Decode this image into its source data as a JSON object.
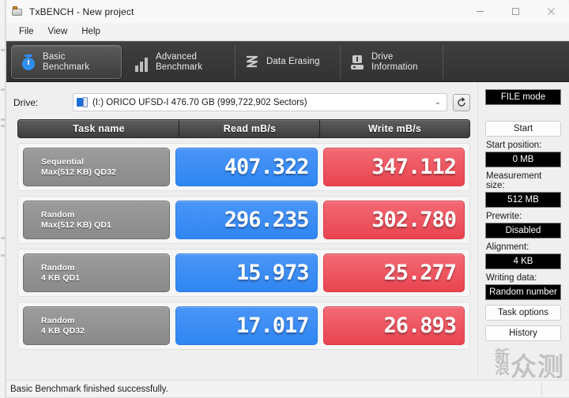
{
  "window": {
    "title": "TxBENCH - New project",
    "app_icon": "txbench-icon",
    "buttons": {
      "minimize": "minimize-icon",
      "maximize": "maximize-icon",
      "close": "close-icon"
    }
  },
  "menubar": {
    "items": [
      {
        "label": "File"
      },
      {
        "label": "View"
      },
      {
        "label": "Help"
      }
    ]
  },
  "tabs": [
    {
      "label": "Basic\nBenchmark",
      "icon": "stopwatch-icon",
      "active": true
    },
    {
      "label": "Advanced\nBenchmark",
      "icon": "bar-chart-icon",
      "active": false
    },
    {
      "label": "Data Erasing",
      "icon": "erase-icon",
      "active": false
    },
    {
      "label": "Drive\nInformation",
      "icon": "hard-drive-icon",
      "active": false
    }
  ],
  "drive": {
    "label": "Drive:",
    "value": "(I:) ORICO UFSD-I  476.70 GB (999,722,902 Sectors)",
    "caret": "⌄",
    "refresh_icon": "refresh-icon"
  },
  "table": {
    "headers": {
      "task": "Task name",
      "read": "Read mB/s",
      "write": "Write mB/s"
    },
    "rows": [
      {
        "task_line1": "Sequential",
        "task_line2": "Max(512 KB) QD32",
        "read": "407.322",
        "write": "347.112"
      },
      {
        "task_line1": "Random",
        "task_line2": "Max(512 KB) QD1",
        "read": "296.235",
        "write": "302.780"
      },
      {
        "task_line1": "Random",
        "task_line2": "4 KB QD1",
        "read": "15.973",
        "write": "25.277"
      },
      {
        "task_line1": "Random",
        "task_line2": "4 KB QD32",
        "read": "17.017",
        "write": "26.893"
      }
    ]
  },
  "sidebar": {
    "mode_button": "FILE mode",
    "start_button": "Start",
    "start_position_label": "Start position:",
    "start_position_value": "0 MB",
    "measurement_size_label": "Measurement size:",
    "measurement_size_value": "512 MB",
    "prewrite_label": "Prewrite:",
    "prewrite_value": "Disabled",
    "alignment_label": "Alignment:",
    "alignment_value": "4 KB",
    "writing_data_label": "Writing data:",
    "writing_data_value": "Random number",
    "task_options_button": "Task options",
    "history_button": "History"
  },
  "statusbar": {
    "text": "Basic Benchmark finished successfully."
  },
  "watermark": {
    "text_small": "新浪",
    "text_large": "众测"
  },
  "colors": {
    "read_blue": "#2f86f2",
    "write_red": "#e9444f",
    "tabstrip": "#3a3a3a",
    "header_gray": "#4c4c4c"
  }
}
